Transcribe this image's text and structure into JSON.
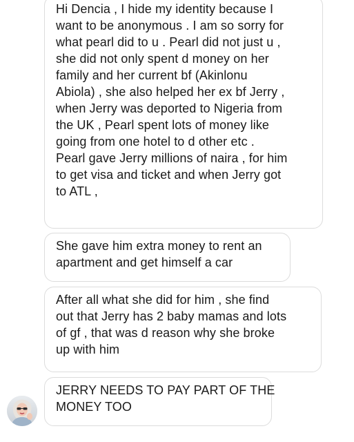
{
  "messages": [
    {
      "lines": [
        "Hi Dencia , I hide my identity because I",
        "want to be anonymous . I am so sorry for",
        "what pearl did to u . Pearl did not just u ,",
        "she did not only spent d money on her",
        "family and her current bf (Akinlonu",
        "Abiola) , she also helped her ex bf Jerry ,",
        "when Jerry was deported  to Nigeria from",
        "the UK , Pearl spent  lots of money like",
        "going from one hotel to d other etc .",
        "Pearl gave Jerry millions of naira , for him",
        "to get visa and ticket and when Jerry got",
        "to ATL  ,"
      ]
    },
    {
      "lines": [
        "She gave him extra money to rent an",
        "apartment and get himself a car"
      ]
    },
    {
      "lines": [
        "After all what she did for him , she find",
        "out that Jerry has 2 baby mamas and lots",
        "of gf , that was d reason why she broke",
        "up with him"
      ]
    },
    {
      "lines": [
        "JERRY NEEDS TO PAY PART OF THE",
        "MONEY TOO"
      ]
    }
  ],
  "sender_avatar": {
    "icon": "user-avatar-photo"
  },
  "colors": {
    "bubble_border": "#dcdcdc",
    "text": "#1a1a1a",
    "background": "#ffffff"
  }
}
